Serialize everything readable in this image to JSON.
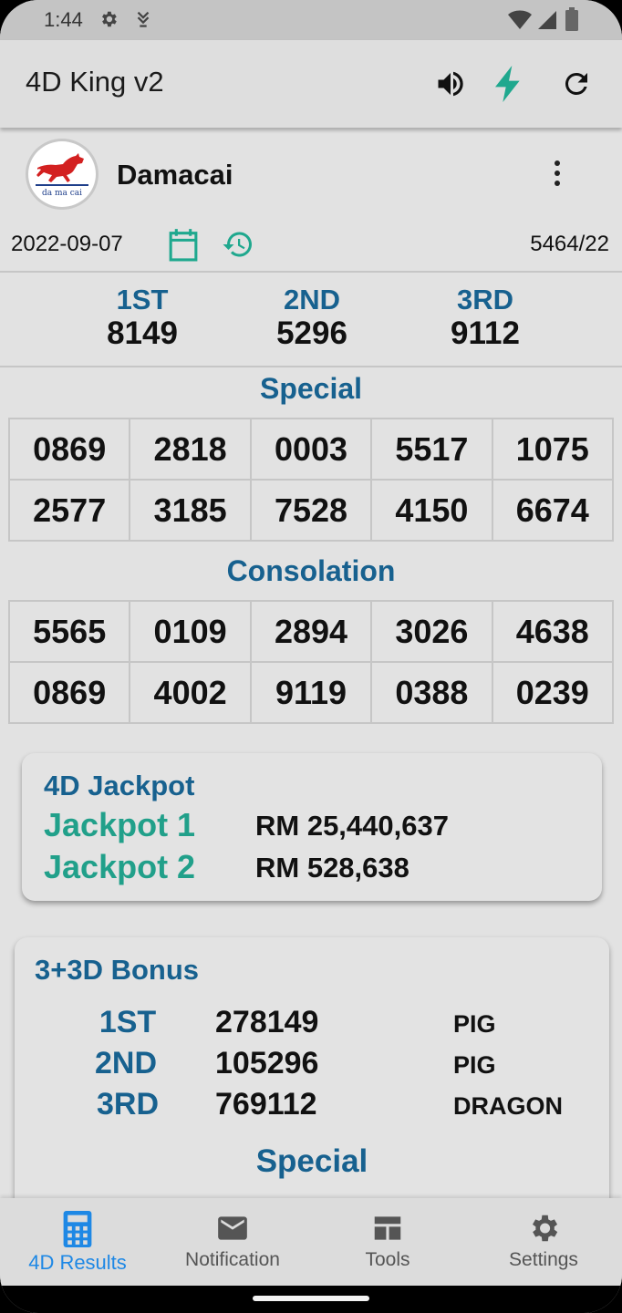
{
  "status_bar": {
    "time": "1:44",
    "icons": [
      "settings-icon",
      "download-icon",
      "wifi-icon",
      "signal-icon",
      "battery-icon"
    ]
  },
  "app_bar": {
    "title": "4D King v2",
    "actions": [
      "volume-icon",
      "flash-icon",
      "refresh-icon"
    ],
    "accent_color": "#1fa88e"
  },
  "provider": {
    "name": "Damacai",
    "logo_text": "da ma cai",
    "date": "2022-09-07",
    "draw_number": "5464/22"
  },
  "top_prizes": [
    {
      "label": "1ST",
      "value": "8149"
    },
    {
      "label": "2ND",
      "value": "5296"
    },
    {
      "label": "3RD",
      "value": "9112"
    }
  ],
  "special": {
    "title": "Special",
    "numbers": [
      "0869",
      "2818",
      "0003",
      "5517",
      "1075",
      "2577",
      "3185",
      "7528",
      "4150",
      "6674"
    ]
  },
  "consolation": {
    "title": "Consolation",
    "numbers": [
      "5565",
      "0109",
      "2894",
      "3026",
      "4638",
      "0869",
      "4002",
      "9119",
      "0388",
      "0239"
    ]
  },
  "jackpot": {
    "title": "4D Jackpot",
    "items": [
      {
        "label": "Jackpot 1",
        "value": "RM 25,440,637"
      },
      {
        "label": "Jackpot 2",
        "value": "RM 528,638"
      }
    ]
  },
  "bonus": {
    "title": "3+3D Bonus",
    "rows": [
      {
        "label": "1ST",
        "value": "278149",
        "animal": "PIG"
      },
      {
        "label": "2ND",
        "value": "105296",
        "animal": "PIG"
      },
      {
        "label": "3RD",
        "value": "769112",
        "animal": "DRAGON"
      }
    ],
    "special_title": "Special"
  },
  "bottom_nav": {
    "items": [
      {
        "label": "4D Results",
        "icon": "calculator-icon",
        "active": true
      },
      {
        "label": "Notification",
        "icon": "mail-icon",
        "active": false
      },
      {
        "label": "Tools",
        "icon": "table-icon",
        "active": false
      },
      {
        "label": "Settings",
        "icon": "gear-icon",
        "active": false
      }
    ],
    "active_color": "#1e88e5"
  }
}
